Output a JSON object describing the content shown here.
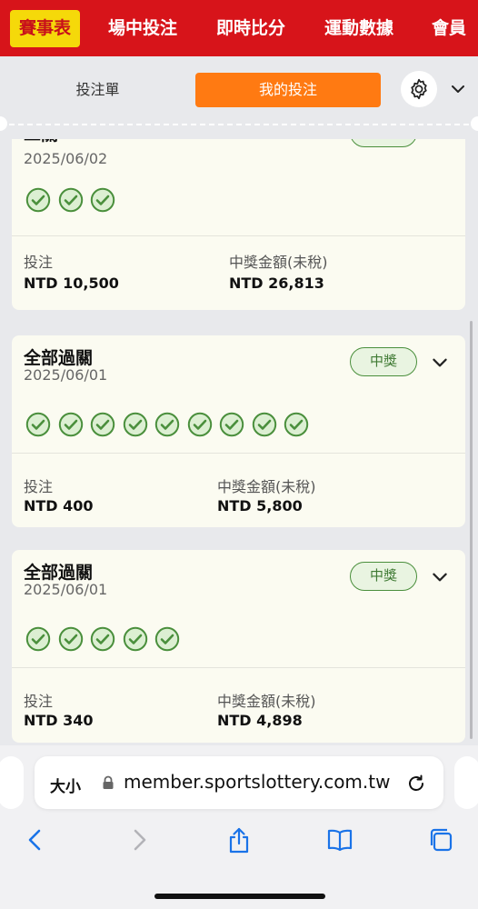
{
  "nav": {
    "items": [
      "賽事表",
      "場中投注",
      "即時比分",
      "運動數據",
      "會員"
    ]
  },
  "tabs": {
    "betslip": "投注單",
    "mybets": "我的投注"
  },
  "cards": [
    {
      "title": "二關",
      "date": "2025/06/02",
      "badge": "中獎",
      "check_count": 3,
      "stake_label": "投注",
      "stake_value": "NTD 10,500",
      "win_label": "中獎金額(未稅)",
      "win_value": "NTD 26,813"
    },
    {
      "title": "全部過關",
      "date": "2025/06/01",
      "badge": "中獎",
      "check_count": 9,
      "stake_label": "投注",
      "stake_value": "NTD 400",
      "win_label": "中獎金額(未稅)",
      "win_value": "NTD 5,800"
    },
    {
      "title": "全部過關",
      "date": "2025/06/01",
      "badge": "中獎",
      "check_count": 5,
      "stake_label": "投注",
      "stake_value": "NTD 340",
      "win_label": "中獎金額(未稅)",
      "win_value": "NTD 4,898"
    }
  ],
  "browser": {
    "text_size": "大小",
    "url": "member.sportslottery.com.tw"
  },
  "colors": {
    "nav_bg": "#d7141a",
    "nav_active_bg": "#f5d90a",
    "tab_active_bg": "#ff7a12",
    "check_green": "#4a8f3c",
    "ios_blue": "#1a73e8"
  },
  "icons": {
    "settings": "gear-icon",
    "expand": "chevron-down-icon",
    "leg": "check-circle-icon",
    "secure": "lock-icon",
    "reload": "reload-icon",
    "back": "chevron-left-icon",
    "forward": "chevron-right-icon",
    "share": "share-icon",
    "bookmarks": "book-icon",
    "tabs": "tabs-icon"
  }
}
